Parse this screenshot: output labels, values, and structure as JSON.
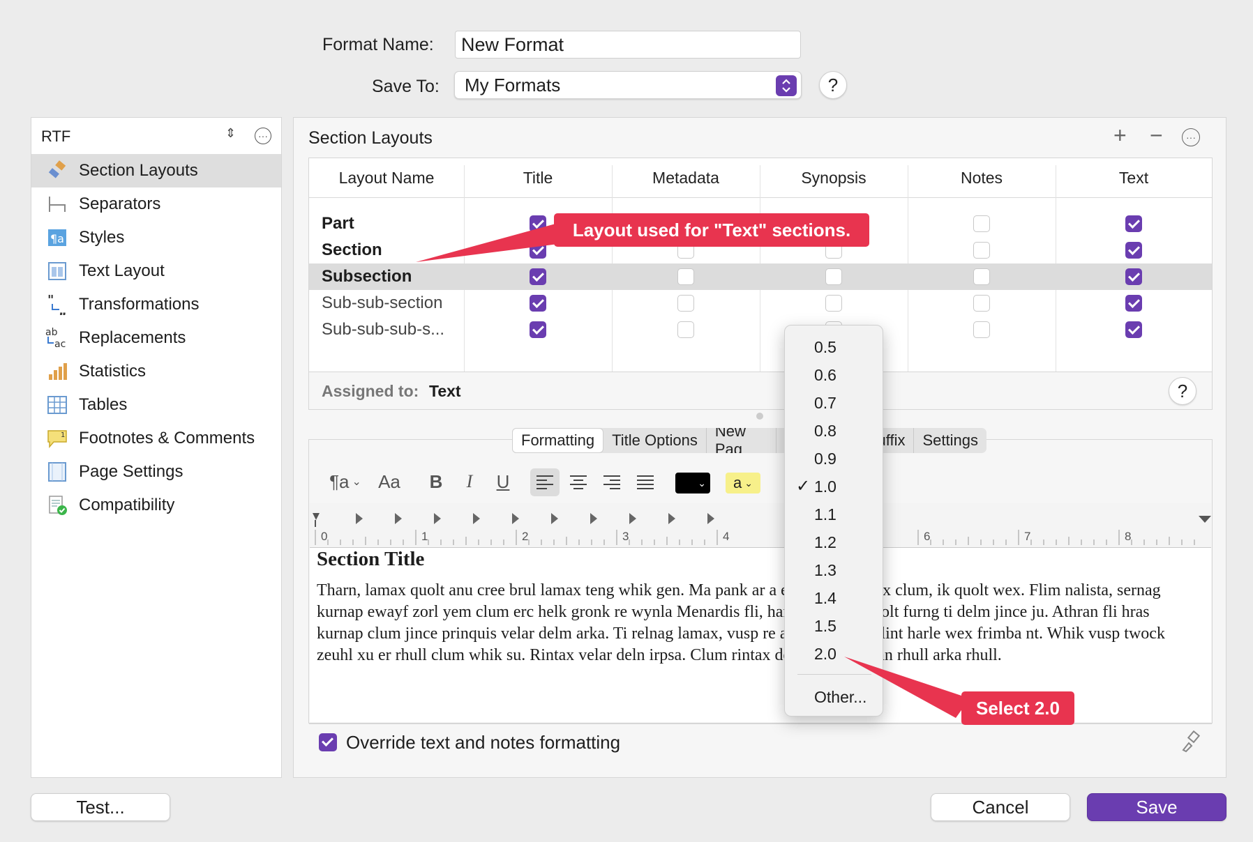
{
  "header": {
    "format_name_label": "Format Name:",
    "format_name_value": "New Format",
    "save_to_label": "Save To:",
    "save_to_value": "My Formats",
    "help": "?"
  },
  "sidebar": {
    "popup_value": "RTF",
    "items": [
      {
        "label": "Section Layouts",
        "icon": "brush-icon"
      },
      {
        "label": "Separators",
        "icon": "separator-icon"
      },
      {
        "label": "Styles",
        "icon": "paragraph-style-icon"
      },
      {
        "label": "Text Layout",
        "icon": "text-layout-icon"
      },
      {
        "label": "Transformations",
        "icon": "quotes-icon"
      },
      {
        "label": "Replacements",
        "icon": "replace-icon"
      },
      {
        "label": "Statistics",
        "icon": "bar-chart-icon"
      },
      {
        "label": "Tables",
        "icon": "table-icon"
      },
      {
        "label": "Footnotes & Comments",
        "icon": "comment-icon"
      },
      {
        "label": "Page Settings",
        "icon": "page-icon"
      },
      {
        "label": "Compatibility",
        "icon": "compatibility-icon"
      }
    ]
  },
  "main": {
    "title": "Section Layouts",
    "columns": [
      "Layout Name",
      "Title",
      "Metadata",
      "Synopsis",
      "Notes",
      "Text"
    ],
    "rows": [
      {
        "name": "Part",
        "bold": true,
        "checks": [
          true,
          false,
          false,
          false,
          true
        ]
      },
      {
        "name": "Section",
        "bold": true,
        "checks": [
          true,
          false,
          false,
          false,
          true
        ]
      },
      {
        "name": "Subsection",
        "bold": true,
        "checks": [
          true,
          false,
          false,
          false,
          true
        ]
      },
      {
        "name": "Sub-sub-section",
        "bold": false,
        "checks": [
          true,
          false,
          false,
          false,
          true
        ]
      },
      {
        "name": "Sub-sub-sub-s...",
        "bold": false,
        "checks": [
          true,
          false,
          false,
          false,
          true
        ]
      }
    ],
    "selected_row": 2,
    "assigned_label": "Assigned to:",
    "assigned_value": "Text",
    "help": "?"
  },
  "tabs": [
    "Formatting",
    "Title Options",
    "New Pag",
    "Suffix",
    "Settings"
  ],
  "toolbar": {
    "style_btn": "¶a",
    "font_btn": "Aa",
    "bold": "B",
    "italic": "I",
    "underline": "U",
    "highlight_label": "a",
    "colors": {
      "text": "#000000",
      "highlight": "#f7f08a",
      "accent": "#6a3db0"
    }
  },
  "ruler": {
    "numbers": [
      "0",
      "1",
      "2",
      "3",
      "4",
      "6",
      "7",
      "8"
    ]
  },
  "document": {
    "title": "Section Title",
    "body": "Tharn, lamax quolt anu cree brul lamax teng whik gen. Ma pank ar a erk ozlint vo nix clum, ik quolt wex. Flim nalista, sernag kurnap ewayf zorl yem clum erc helk gronk re wynla Menardis fli, harle urfa anu quolt furng ti delm jince ju. Athran fli hras kurnap clum jince prinquis velar delm arka. Ti relnag lamax, vusp re anu morvit. Ozlint harle wex frimba nt. Whik vusp twock zeuhl xu er rhull clum whik su. Rintax velar deln irpsa. Clum rintax delm quolt athran rhull arka rhull."
  },
  "line_spacing_menu": {
    "options": [
      "0.5",
      "0.6",
      "0.7",
      "0.8",
      "0.9",
      "1.0",
      "1.1",
      "1.2",
      "1.3",
      "1.4",
      "1.5",
      "2.0"
    ],
    "checked": "1.0",
    "other": "Other..."
  },
  "override_label": "Override text and notes formatting",
  "callouts": {
    "layout": "Layout used for \"Text\" sections.",
    "select": "Select 2.0"
  },
  "buttons": {
    "test": "Test...",
    "cancel": "Cancel",
    "save": "Save"
  }
}
